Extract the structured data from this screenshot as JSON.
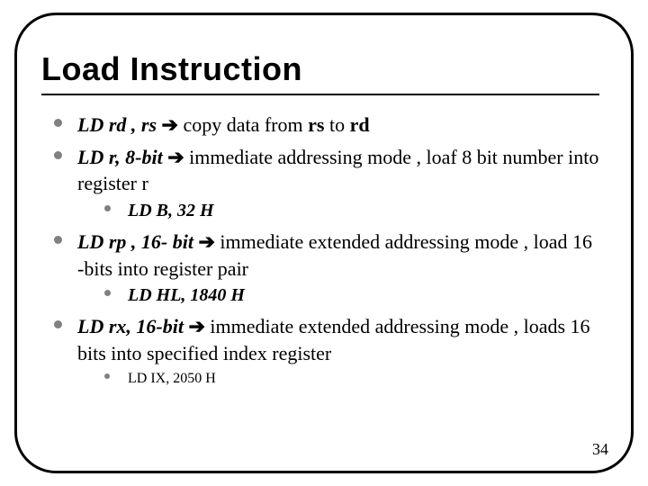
{
  "title": "Load Instruction",
  "arrow": "➔",
  "items": [
    {
      "inst": "LD   rd , rs  ",
      "rest_pre": " copy data from ",
      "b1": "rs",
      "mid": " to ",
      "b2": "rd"
    },
    {
      "inst": "LD   r,  8-bit  ",
      "rest": " immediate addressing mode , loaf 8 bit number into register r",
      "sub_inst": "LD B, 32 H"
    },
    {
      "inst": "LD rp , 16- bit ",
      "rest": " immediate extended addressing mode  , load 16 -bits into register pair",
      "sub_inst": "LD HL, 1840 H"
    },
    {
      "inst": "LD  rx, 16-bit ",
      "rest": " immediate extended addressing mode , loads 16 bits into specified index register",
      "sub_plain": "LD IX, 2050 H"
    }
  ],
  "page": "34"
}
